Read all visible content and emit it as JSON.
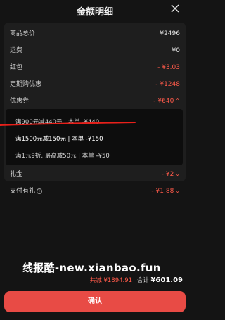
{
  "header": {
    "title": "金额明细"
  },
  "rows": {
    "goods": {
      "label": "商品总价",
      "value": "¥2496"
    },
    "shipping": {
      "label": "运费",
      "value": "¥0"
    },
    "redpacket": {
      "label": "红包",
      "value": "- ¥3.03"
    },
    "periodic": {
      "label": "定期购优惠",
      "value": "- ¥1248"
    },
    "coupon": {
      "label": "优惠券",
      "value": "- ¥640"
    },
    "gift": {
      "label": "礼金",
      "value": "- ¥2"
    },
    "payment": {
      "label": "支付有礼",
      "value": "- ¥1.88"
    }
  },
  "coupons": [
    {
      "text": "满900元减440元 | 本单 -¥440"
    },
    {
      "text": "满1500元减150元 | 本单 -¥150"
    },
    {
      "text": "满1元9折, 最高减50元 | 本单 -¥50"
    }
  ],
  "watermark": "线报酷-new.xianbao.fun",
  "summary": {
    "saved": "共减 ¥1894.91",
    "total_label": "合计",
    "total": "¥601.09"
  },
  "confirm_label": "确认",
  "colors": {
    "accent": "#ff5a4a",
    "button": "#e84b45",
    "background": "#141414"
  },
  "icons": {
    "close": "close-icon",
    "chevron": "chevron-icon",
    "info": "info-icon"
  }
}
